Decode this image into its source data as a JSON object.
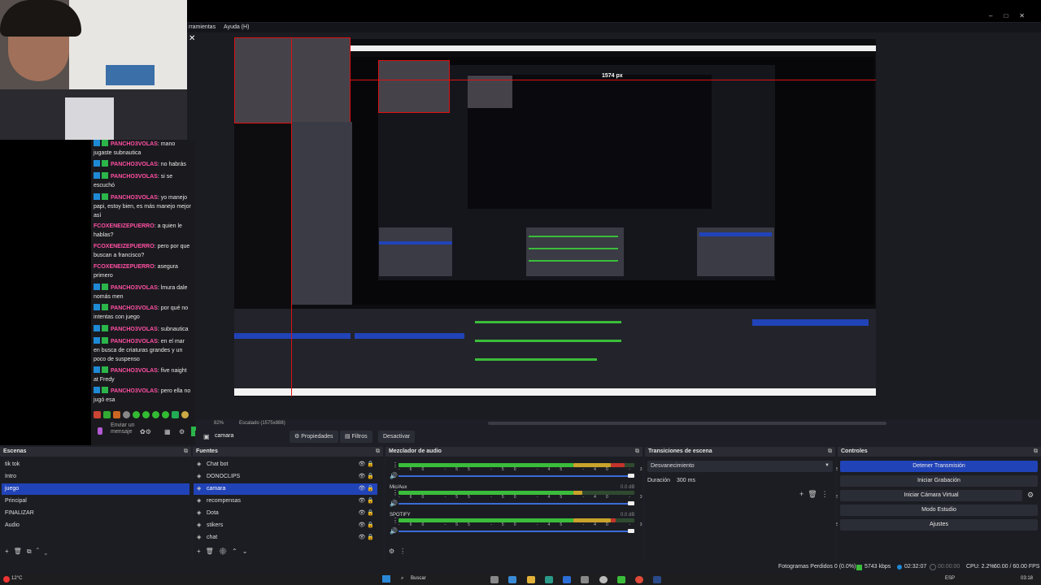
{
  "menu": {
    "items": [
      "rramientas",
      "Ayuda (H)"
    ]
  },
  "preview": {
    "dimension_label": "1574 px",
    "zoom": "82%",
    "scale": "Escalado (1575x888)"
  },
  "chat": {
    "messages": [
      {
        "user": "PANCHO3VOLAS",
        "text": "mano jugaste subnautica",
        "style": "green"
      },
      {
        "user": "PANCHO3VOLAS",
        "text": "no habrás",
        "style": "green"
      },
      {
        "user": "PANCHO3VOLAS",
        "text": "si se escuchó",
        "style": "green"
      },
      {
        "user": "PANCHO3VOLAS",
        "text": "yo manejo papi, estoy bien, es más manejo mejor así",
        "style": "green"
      },
      {
        "user": "FCOXENEIZEPUERRO",
        "text": "a quien le hablas?",
        "style": "plain"
      },
      {
        "user": "FCOXENEIZEPUERRO",
        "text": "pero por que buscan a francisco?",
        "style": "plain"
      },
      {
        "user": "FCOXENEIZEPUERRO",
        "text": "asegura primero",
        "style": "plain"
      },
      {
        "user": "PANCHO3VOLAS",
        "text": "lmura dale nomás men",
        "style": "green"
      },
      {
        "user": "PANCHO3VOLAS",
        "text": "por qué no intentas con juego",
        "style": "green"
      },
      {
        "user": "PANCHO3VOLAS",
        "text": "subnautica",
        "style": "green"
      },
      {
        "user": "PANCHO3VOLAS",
        "text": "en el mar en busca de criaturas grandes y un poco de suspenso",
        "style": "green"
      },
      {
        "user": "PANCHO3VOLAS",
        "text": "five naight at Fredy",
        "style": "green"
      },
      {
        "user": "PANCHO3VOLAS",
        "text": "pero ella no jugó esa",
        "style": "green"
      }
    ],
    "send_label": "Enviar un mensaje"
  },
  "toolbar": {
    "source_name": "camara",
    "properties_label": "Propiedades",
    "filters_label": "Filtros",
    "deactivate_label": "Desactivar"
  },
  "scenes": {
    "title": "Escenas",
    "items": [
      "tik tok",
      "Intro",
      "juego",
      "Principal",
      "FINALIZAR",
      "Audio"
    ],
    "selected": "juego"
  },
  "sources": {
    "title": "Fuentes",
    "items": [
      "Chat bot",
      "DONOCLIPS",
      "camara",
      "recompensas",
      "Dota",
      "stikers",
      "chat"
    ],
    "selected": "camara"
  },
  "mixer": {
    "title": "Mezclador de audio",
    "tracks": [
      {
        "name": "",
        "db": "",
        "level": 0.96
      },
      {
        "name": "Mic/Aux",
        "db": "0.0 dB",
        "level": 0.78
      },
      {
        "name": "SPOTIFY",
        "db": "0.0 dB",
        "level": 0.92
      }
    ],
    "ticks": [
      "-60",
      "-55",
      "-50",
      "-45",
      "-40",
      "-35",
      "-30",
      "-25",
      "-20",
      "-15",
      "-10",
      "-5",
      "0"
    ]
  },
  "transitions": {
    "title": "Transiciones de escena",
    "selected": "Desvanecimiento",
    "duration_label": "Duración",
    "duration_value": "300 ms"
  },
  "controls": {
    "title": "Controles",
    "buttons": [
      "Detener Transmisión",
      "Iniciar Grabación",
      "Iniciar Cámara Virtual",
      "Modo Estudio",
      "Ajustes"
    ]
  },
  "status": {
    "dropped": "Fotogramas Perdidos 0 (0.0%)",
    "bitrate": "5743 kbps",
    "stream_time": "02:32:07",
    "rec_time": "00:00:00",
    "cpu": "CPU: 2.2%",
    "fps": "60.00 / 60.00 FPS"
  },
  "taskbar": {
    "weather": "12°C",
    "search": "Buscar",
    "lang": "ESP",
    "time": "03:18"
  },
  "colors": {
    "accent": "#2143b8",
    "live_red": "#d11",
    "chat_user": "#ff4fa3",
    "meter_green": "#3bbd3b"
  }
}
